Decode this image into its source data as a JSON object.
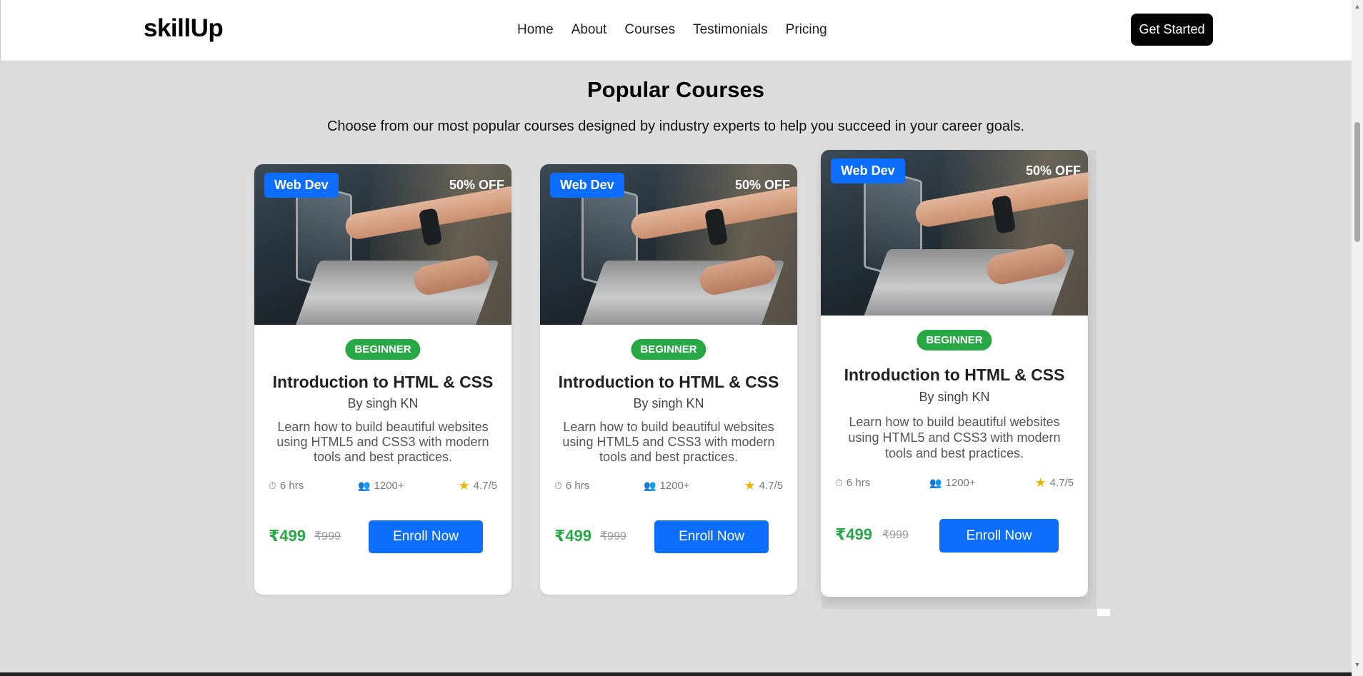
{
  "header": {
    "brand": "skillUp",
    "nav": [
      "Home",
      "About",
      "Courses",
      "Testimonials",
      "Pricing"
    ],
    "cta": "Get Started"
  },
  "section": {
    "title": "Popular Courses",
    "subtitle": "Choose from our most popular courses designed by industry experts to help you succeed in your career goals."
  },
  "courses": [
    {
      "category": "Web Dev",
      "discount": "50% OFF",
      "level": "BEGINNER",
      "title": "Introduction to HTML & CSS",
      "author": "By singh KN",
      "description": "Learn how to build beautiful websites using HTML5 and CSS3 with modern tools and best practices.",
      "duration": "6 hrs",
      "students": "1200+",
      "rating": "4.7/5",
      "price": "₹499",
      "old_price": "₹999",
      "button": "Enroll Now"
    },
    {
      "category": "Web Dev",
      "discount": "50% OFF",
      "level": "BEGINNER",
      "title": "Introduction to HTML & CSS",
      "author": "By singh KN",
      "description": "Learn how to build beautiful websites using HTML5 and CSS3 with modern tools and best practices.",
      "duration": "6 hrs",
      "students": "1200+",
      "rating": "4.7/5",
      "price": "₹499",
      "old_price": "₹999",
      "button": "Enroll Now"
    },
    {
      "category": "Web Dev",
      "discount": "50% OFF",
      "level": "BEGINNER",
      "title": "Introduction to HTML & CSS",
      "author": "By singh KN",
      "description": "Learn how to build beautiful websites using HTML5 and CSS3 with modern tools and best practices.",
      "duration": "6 hrs",
      "students": "1200+",
      "rating": "4.7/5",
      "price": "₹499",
      "old_price": "₹999",
      "button": "Enroll Now"
    }
  ],
  "icons": {
    "clock": "clock-icon",
    "users": "users-icon",
    "star": "star-icon"
  },
  "colors": {
    "primary": "#0d6efd",
    "success": "#28a745",
    "star": "#f0b400",
    "cta_bg": "#050505",
    "page_bg": "#dddddd"
  }
}
